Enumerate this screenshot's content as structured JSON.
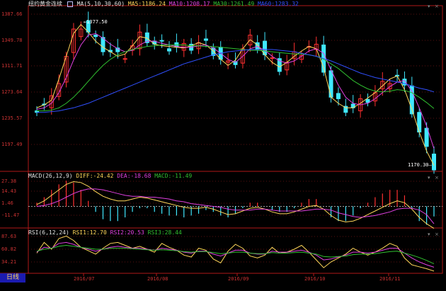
{
  "main": {
    "symbol": "纽约黄金连续",
    "indicator_params": "MA(5,10,30,60)",
    "ma_values": [
      {
        "name": "MA5",
        "value": "1186.24",
        "color": "#ffd75a"
      },
      {
        "name": "MA10",
        "value": "1208.17",
        "color": "#e040e0"
      },
      {
        "name": "MA30",
        "value": "1261.49",
        "color": "#30c030"
      },
      {
        "name": "MA60",
        "value": "1283.32",
        "color": "#3050ff"
      }
    ],
    "y_ticks": [
      "1387.66",
      "1349.78",
      "1311.71",
      "1273.64",
      "1235.57",
      "1197.49"
    ],
    "high_annotation": "1377.50",
    "last_annotation": "1170.30"
  },
  "macd": {
    "title": "MACD(26,12,9)",
    "diff": "DIFF:-24.42",
    "dea": "DEA:-18.68",
    "macd": "MACD:-11.49",
    "y_ticks": [
      "27.38",
      "14.43",
      "1.46",
      "-11.47"
    ]
  },
  "rsi": {
    "title": "RSI(6,12,24)",
    "rsi1": "RSI1:12.70",
    "rsi2": "RSI2:20.53",
    "rsi3": "RSI3:28.44",
    "y_ticks": [
      "87.63",
      "60.82",
      "34.21"
    ]
  },
  "x_axis": {
    "labels": [
      "2016/07",
      "2016/08",
      "2016/09",
      "2016/10",
      "2016/11"
    ]
  },
  "period_tab": "日线",
  "colors": {
    "up": "#ff3030",
    "down": "#40e8ff",
    "axis": "#b01818",
    "ma5": "#ffd75a",
    "ma10": "#e040e0",
    "ma30": "#30c030",
    "ma60": "#3050ff"
  },
  "chart_data": [
    {
      "type": "candlestick",
      "title": "纽约黄金连续",
      "series": [
        {
          "name": "MA5",
          "values": [
            1262,
            1266,
            1272,
            1300,
            1330,
            1360,
            1372,
            1362,
            1350,
            1342,
            1336,
            1330,
            1333,
            1344,
            1356,
            1354,
            1346,
            1344,
            1343,
            1342,
            1341,
            1344,
            1348,
            1345,
            1337,
            1326,
            1318,
            1325,
            1340,
            1352,
            1345,
            1332,
            1322,
            1316,
            1322,
            1330,
            1337,
            1343,
            1340,
            1315,
            1276,
            1268,
            1262,
            1262,
            1268,
            1275,
            1282,
            1291,
            1300,
            1304,
            1286,
            1260,
            1230,
            1205,
            1186
          ]
        },
        {
          "name": "MA10",
          "values": [
            1260,
            1262,
            1268,
            1282,
            1302,
            1325,
            1345,
            1358,
            1360,
            1354,
            1346,
            1340,
            1336,
            1338,
            1345,
            1350,
            1350,
            1347,
            1345,
            1343,
            1342,
            1342,
            1344,
            1345,
            1341,
            1334,
            1326,
            1322,
            1330,
            1340,
            1343,
            1338,
            1330,
            1324,
            1321,
            1324,
            1330,
            1337,
            1340,
            1334,
            1312,
            1292,
            1276,
            1268,
            1266,
            1268,
            1274,
            1282,
            1290,
            1296,
            1298,
            1284,
            1262,
            1238,
            1208
          ]
        },
        {
          "name": "MA30",
          "values": [
            1258,
            1258,
            1259,
            1262,
            1268,
            1276,
            1286,
            1297,
            1308,
            1318,
            1326,
            1332,
            1336,
            1339,
            1341,
            1343,
            1344,
            1345,
            1345,
            1345,
            1345,
            1344,
            1344,
            1343,
            1343,
            1342,
            1341,
            1340,
            1339,
            1338,
            1338,
            1337,
            1336,
            1335,
            1334,
            1333,
            1333,
            1332,
            1330,
            1326,
            1320,
            1314,
            1306,
            1298,
            1292,
            1287,
            1284,
            1283,
            1284,
            1286,
            1285,
            1282,
            1276,
            1269,
            1261
          ]
        },
        {
          "name": "MA60",
          "values": [
            1256,
            1256,
            1257,
            1258,
            1260,
            1262,
            1265,
            1268,
            1272,
            1276,
            1280,
            1284,
            1288,
            1292,
            1296,
            1300,
            1304,
            1308,
            1312,
            1316,
            1320,
            1323,
            1326,
            1329,
            1332,
            1334,
            1336,
            1337,
            1338,
            1339,
            1339,
            1339,
            1339,
            1338,
            1337,
            1336,
            1334,
            1332,
            1330,
            1327,
            1324,
            1320,
            1316,
            1312,
            1308,
            1305,
            1302,
            1300,
            1298,
            1296,
            1294,
            1291,
            1288,
            1286,
            1283
          ]
        }
      ],
      "last_close": 1170.3,
      "high": 1377.5,
      "ylim": [
        1180,
        1395
      ]
    },
    {
      "type": "line",
      "title": "MACD(26,12,9)",
      "series": [
        {
          "name": "DIFF",
          "values": [
            2,
            6,
            12,
            18,
            24,
            27,
            26,
            22,
            16,
            11,
            8,
            6,
            6,
            8,
            10,
            9,
            7,
            5,
            3,
            1,
            -1,
            -2,
            -2,
            -1,
            -3,
            -6,
            -9,
            -8,
            -5,
            -2,
            -1,
            -3,
            -6,
            -8,
            -8,
            -6,
            -3,
            0,
            1,
            -3,
            -10,
            -15,
            -17,
            -16,
            -13,
            -9,
            -5,
            -1,
            3,
            6,
            4,
            -3,
            -12,
            -19,
            -24
          ]
        },
        {
          "name": "DEA",
          "values": [
            0,
            1,
            3,
            6,
            10,
            14,
            17,
            19,
            19,
            18,
            16,
            14,
            12,
            11,
            11,
            10,
            10,
            9,
            8,
            6,
            5,
            3,
            2,
            1,
            0,
            -1,
            -3,
            -4,
            -4,
            -4,
            -3,
            -3,
            -4,
            -5,
            -5,
            -5,
            -5,
            -4,
            -3,
            -3,
            -4,
            -7,
            -9,
            -11,
            -12,
            -11,
            -10,
            -8,
            -6,
            -3,
            -2,
            -2,
            -4,
            -9,
            -19
          ]
        },
        {
          "name": "MACD",
          "values": [
            4,
            10,
            18,
            24,
            28,
            26,
            18,
            6,
            -6,
            -14,
            -16,
            -16,
            -12,
            -6,
            -2,
            -2,
            -6,
            -8,
            -10,
            -10,
            -12,
            -10,
            -8,
            -4,
            -6,
            -10,
            -12,
            -8,
            -2,
            4,
            4,
            0,
            -4,
            -6,
            -6,
            -2,
            4,
            8,
            8,
            0,
            -12,
            -16,
            -16,
            -10,
            -2,
            4,
            10,
            14,
            18,
            18,
            12,
            -2,
            -16,
            -20,
            -11
          ]
        }
      ],
      "ylim": [
        -22,
        32
      ]
    },
    {
      "type": "line",
      "title": "RSI(6,12,24)",
      "series": [
        {
          "name": "RSI1",
          "values": [
            50,
            72,
            58,
            80,
            85,
            76,
            62,
            55,
            48,
            60,
            70,
            72,
            66,
            60,
            64,
            58,
            52,
            70,
            62,
            56,
            46,
            42,
            60,
            56,
            38,
            30,
            54,
            68,
            60,
            44,
            40,
            46,
            62,
            50,
            52,
            58,
            66,
            52,
            36,
            20,
            32,
            40,
            48,
            60,
            52,
            46,
            52,
            60,
            70,
            64,
            40,
            26,
            22,
            18,
            13
          ]
        },
        {
          "name": "RSI2",
          "values": [
            52,
            62,
            60,
            70,
            72,
            68,
            62,
            58,
            54,
            58,
            62,
            64,
            62,
            60,
            60,
            58,
            56,
            60,
            58,
            56,
            52,
            50,
            54,
            54,
            48,
            44,
            50,
            56,
            56,
            50,
            48,
            48,
            54,
            52,
            52,
            54,
            56,
            52,
            46,
            36,
            38,
            42,
            46,
            52,
            52,
            50,
            52,
            56,
            60,
            60,
            50,
            40,
            32,
            26,
            21
          ]
        },
        {
          "name": "RSI3",
          "values": [
            54,
            58,
            60,
            64,
            66,
            64,
            62,
            60,
            58,
            58,
            60,
            60,
            60,
            59,
            58,
            57,
            56,
            57,
            56,
            55,
            53,
            52,
            53,
            53,
            51,
            49,
            50,
            52,
            52,
            50,
            49,
            49,
            51,
            50,
            50,
            51,
            52,
            50,
            48,
            43,
            42,
            43,
            44,
            47,
            48,
            48,
            49,
            51,
            53,
            54,
            50,
            46,
            41,
            35,
            28
          ]
        }
      ],
      "ylim": [
        10,
        90
      ]
    }
  ]
}
